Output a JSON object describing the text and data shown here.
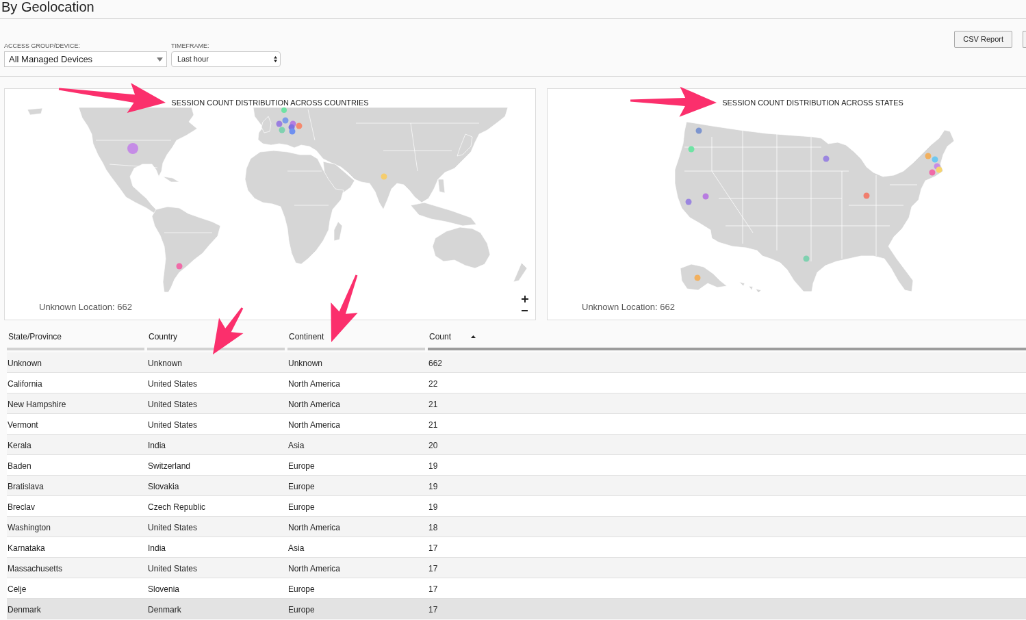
{
  "page_title": "By Geolocation",
  "filters": [
    {
      "kind": "dropdown",
      "label": "ACCESS GROUP/DEVICE:",
      "value": "All Managed Devices"
    },
    {
      "kind": "select",
      "label": "TIMEFRAME:",
      "value": "Last hour"
    }
  ],
  "toolbar": {
    "buttons": [
      "CSV Report"
    ]
  },
  "maps": [
    {
      "kind": "world",
      "title": "SESSION COUNT DISTRIBUTION ACROSS COUNTRIES",
      "unknown_location": "Unknown Location: 662",
      "zoom_controls": true
    },
    {
      "kind": "states",
      "title": "SESSION COUNT DISTRIBUTION ACROSS STATES",
      "unknown_location": "Unknown Location: 662",
      "zoom_controls": false
    }
  ],
  "table": {
    "columns": [
      {
        "label": "State/Province",
        "sorted": false
      },
      {
        "label": "Country",
        "sorted": false
      },
      {
        "label": "Continent",
        "sorted": false
      },
      {
        "label": "Count",
        "sorted": true
      }
    ],
    "rows": [
      {
        "cells": [
          "Unknown",
          "Unknown",
          "Unknown",
          "662"
        ],
        "highlighted": false
      },
      {
        "cells": [
          "California",
          "United States",
          "North America",
          "22"
        ],
        "highlighted": false
      },
      {
        "cells": [
          "New Hampshire",
          "United States",
          "North America",
          "21"
        ],
        "highlighted": false
      },
      {
        "cells": [
          "Vermont",
          "United States",
          "North America",
          "21"
        ],
        "highlighted": false
      },
      {
        "cells": [
          "Kerala",
          "India",
          "Asia",
          "20"
        ],
        "highlighted": false
      },
      {
        "cells": [
          "Baden",
          "Switzerland",
          "Europe",
          "19"
        ],
        "highlighted": false
      },
      {
        "cells": [
          "Bratislava",
          "Slovakia",
          "Europe",
          "19"
        ],
        "highlighted": false
      },
      {
        "cells": [
          "Breclav",
          "Czech Republic",
          "Europe",
          "19"
        ],
        "highlighted": false
      },
      {
        "cells": [
          "Washington",
          "United States",
          "North America",
          "18"
        ],
        "highlighted": false
      },
      {
        "cells": [
          "Karnataka",
          "India",
          "Asia",
          "17"
        ],
        "highlighted": false
      },
      {
        "cells": [
          "Massachusetts",
          "United States",
          "North America",
          "17"
        ],
        "highlighted": false
      },
      {
        "cells": [
          "Celje",
          "Slovenia",
          "Europe",
          "17"
        ],
        "highlighted": false
      },
      {
        "cells": [
          "Denmark",
          "Denmark",
          "Europe",
          "17"
        ],
        "highlighted": true
      }
    ]
  }
}
